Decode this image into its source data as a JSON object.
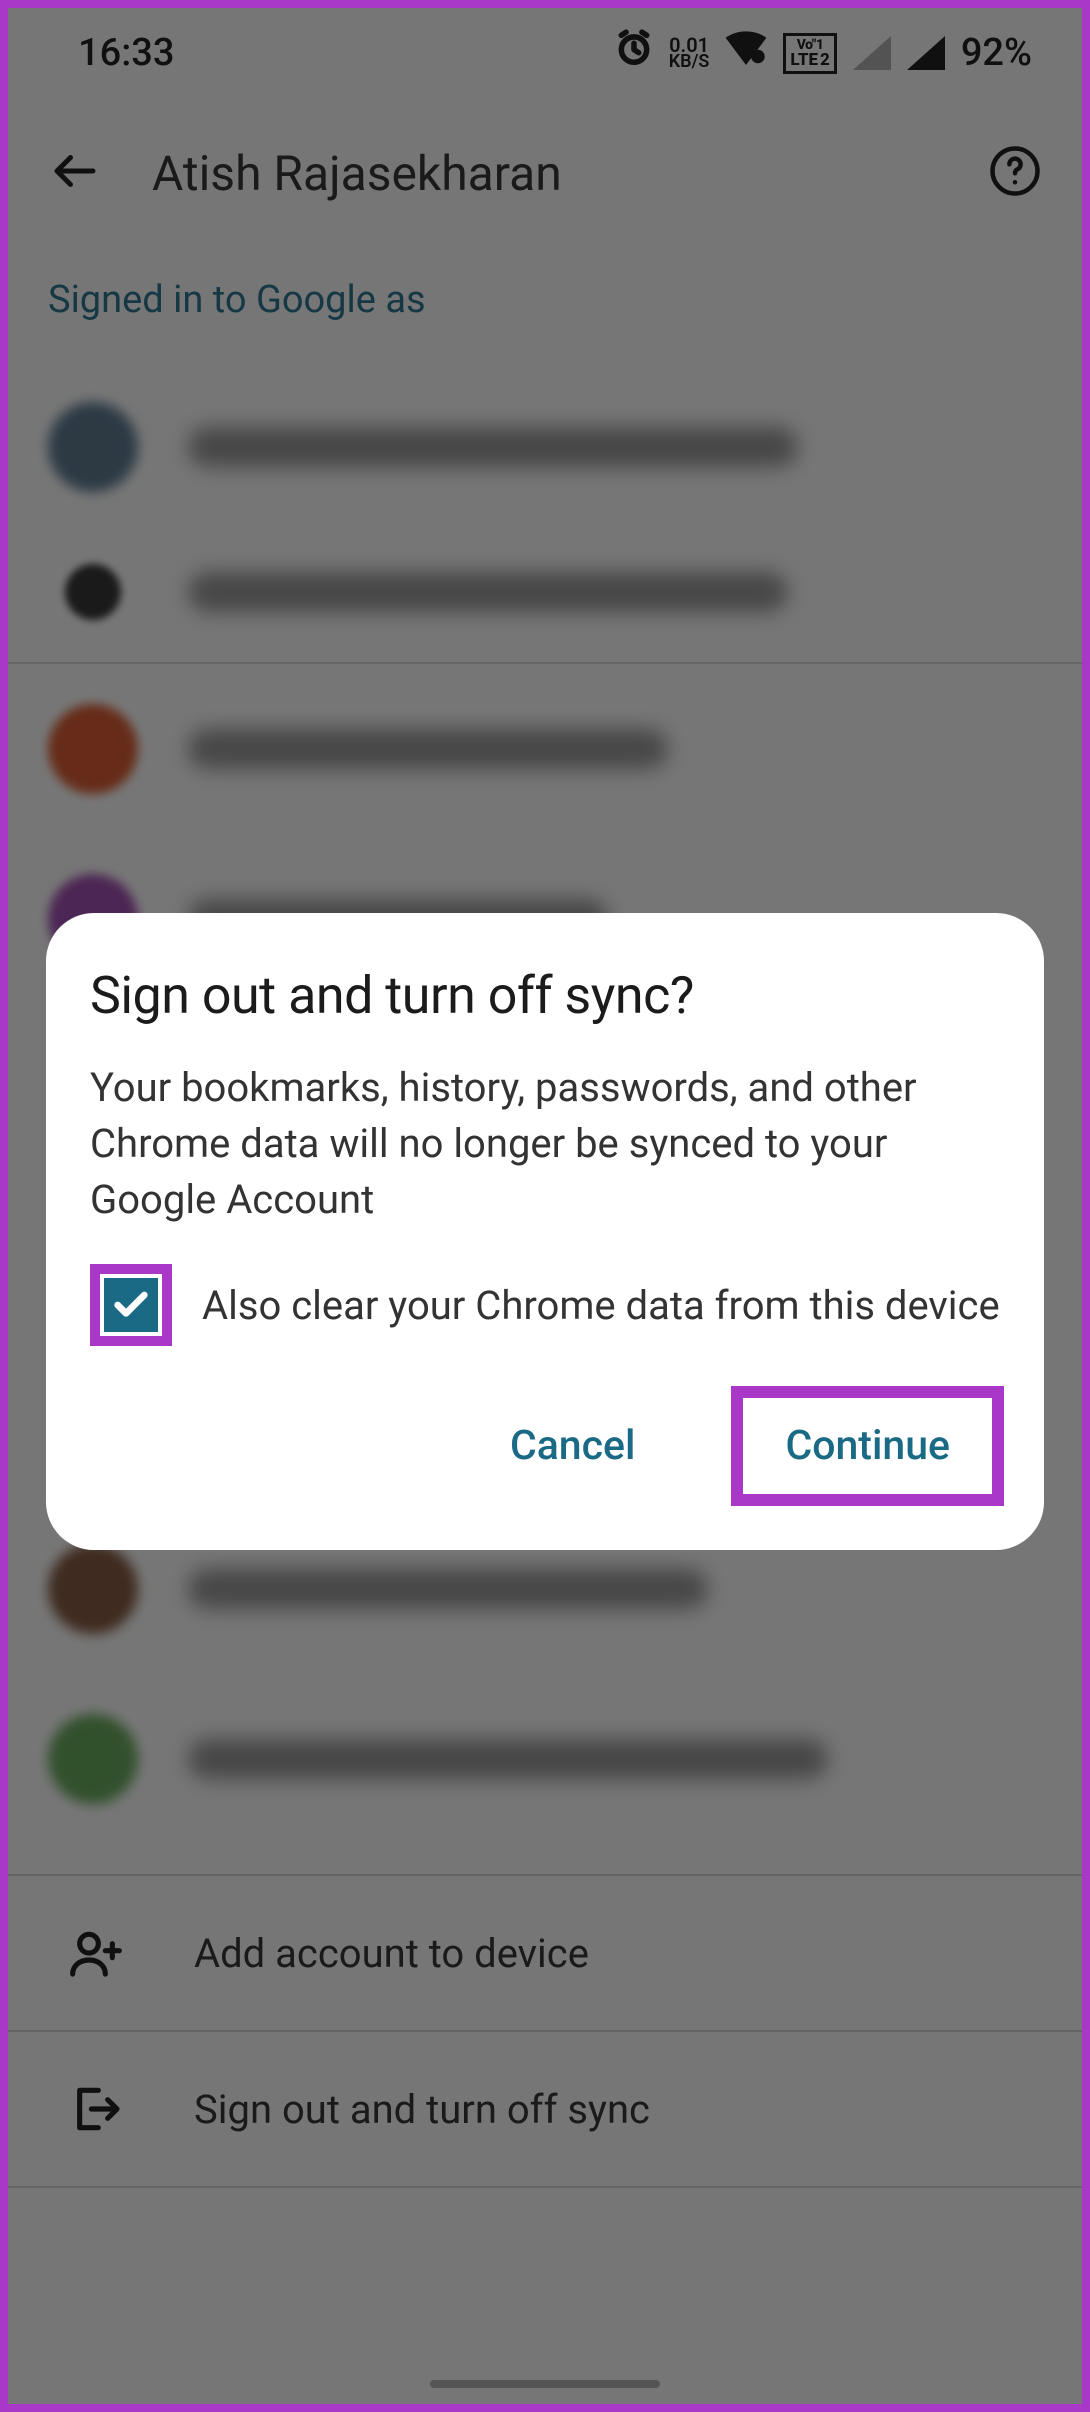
{
  "statusbar": {
    "time": "16:33",
    "data_rate": "0.01",
    "data_unit": "KB/S",
    "lte_top": "Vo\"1",
    "lte_bottom1": "LTE",
    "lte_bottom2": "2",
    "battery": "92%"
  },
  "header": {
    "title": "Atish Rajasekharan"
  },
  "section": {
    "label": "Signed in to Google as"
  },
  "actions": {
    "add_account": "Add account to device",
    "sign_out": "Sign out and turn off sync"
  },
  "dialog": {
    "title": "Sign out and turn off sync?",
    "body": "Your bookmarks, history, passwords, and other Chrome data will no longer be synced to your Google Account",
    "checkbox_label": "Also clear your Chrome data from this device",
    "checkbox_checked": true,
    "cancel": "Cancel",
    "continue": "Continue"
  },
  "colors": {
    "accent": "#1a6a86",
    "highlight": "#a938c8"
  }
}
